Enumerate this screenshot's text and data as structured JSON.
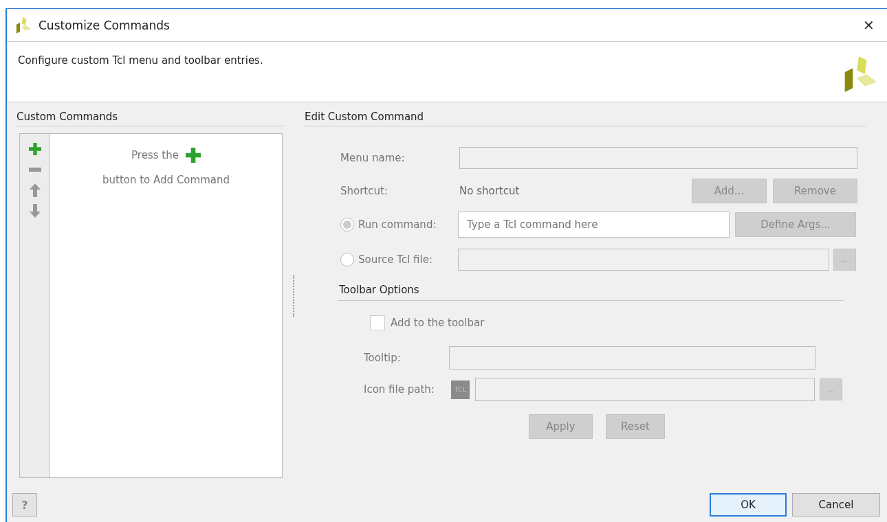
{
  "window": {
    "title": "Customize Commands",
    "close": "✕"
  },
  "header": {
    "description": "Configure custom Tcl menu and toolbar entries."
  },
  "custom_commands": {
    "title": "Custom Commands",
    "tools": [
      {
        "kind": "add",
        "disabled": false
      },
      {
        "kind": "remove",
        "disabled": true
      },
      {
        "kind": "up",
        "disabled": true
      },
      {
        "kind": "down",
        "disabled": true
      }
    ],
    "hint_before": "Press the",
    "hint_after": "button to Add Command"
  },
  "edit": {
    "title": "Edit Custom Command",
    "menu_name": {
      "label": "Menu name:",
      "disabled": true
    },
    "shortcut": {
      "label": "Shortcut:",
      "value": "No shortcut",
      "buttons": [
        {
          "label": "Add...",
          "disabled": true
        },
        {
          "label": "Remove",
          "disabled": true
        }
      ]
    },
    "run_command": {
      "label": "Run command:",
      "selected": true,
      "placeholder": "Type a Tcl command here",
      "button": {
        "label": "Define Args...",
        "disabled": true
      }
    },
    "source_file": {
      "label": "Source Tcl file:",
      "selected": false,
      "browse": "..."
    },
    "toolbar_options": {
      "title": "Toolbar Options",
      "add_to_toolbar": {
        "label": "Add to the toolbar",
        "checked": false
      },
      "tooltip": {
        "label": "Tooltip:"
      },
      "icon_path": {
        "label": "Icon file path:",
        "icon_text": "TCL",
        "browse": "..."
      },
      "buttons": [
        {
          "label": "Apply",
          "disabled": true
        },
        {
          "label": "Reset",
          "disabled": true
        }
      ]
    }
  },
  "footer": {
    "help": "?",
    "buttons": [
      {
        "label": "OK",
        "default": true
      },
      {
        "label": "Cancel",
        "default": false
      }
    ]
  }
}
